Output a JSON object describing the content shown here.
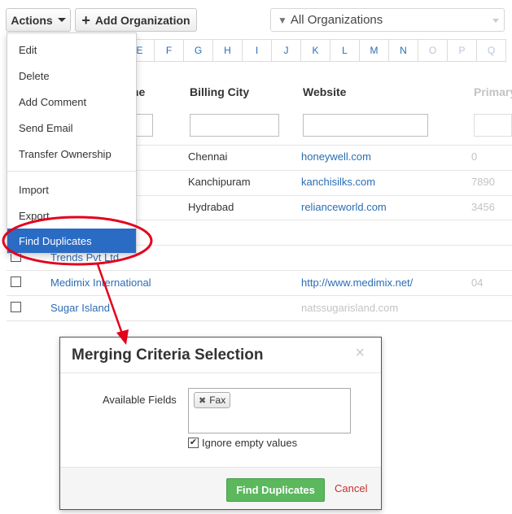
{
  "toolbar": {
    "actions_label": "Actions",
    "add_org_label": "Add Organization",
    "filter_select": "All Organizations"
  },
  "alphabet": [
    "E",
    "F",
    "G",
    "H",
    "I",
    "J",
    "K",
    "L",
    "M",
    "N",
    "O",
    "P",
    "Q"
  ],
  "table": {
    "headers": {
      "name_partial": "me",
      "billing_city": "Billing City",
      "website": "Website",
      "primary": "Primary"
    },
    "rows": [
      {
        "name": "",
        "city": "Chennai",
        "website": "honeywell.com",
        "phone": "0"
      },
      {
        "name": "",
        "city": "Kanchipuram",
        "website": "kanchisilks.com",
        "phone": "7890"
      },
      {
        "name": "",
        "city": "Hydrabad",
        "website": "relianceworld.com",
        "phone": "3456"
      },
      {
        "name": "Trends Pvt Ltd",
        "city": "",
        "website": "",
        "phone": ""
      },
      {
        "name": "Medimix International",
        "city": "",
        "website": "http://www.medimix.net/",
        "phone": "04"
      },
      {
        "name": "Sugar Island",
        "city": "",
        "website": "natssugarisland.com",
        "phone": ""
      }
    ]
  },
  "actions_menu": {
    "items": [
      "Edit",
      "Delete",
      "Add Comment",
      "Send Email",
      "Transfer Ownership",
      "Import",
      "Export",
      "Find Duplicates"
    ],
    "active": "Find Duplicates"
  },
  "modal": {
    "title": "Merging Criteria Selection",
    "close_symbol": "×",
    "fields_label": "Available Fields",
    "selected_fields": [
      "Fax"
    ],
    "ignore_empty_label": "Ignore empty values",
    "ignore_empty_checked": true,
    "primary_button": "Find Duplicates",
    "cancel_label": "Cancel"
  },
  "colors": {
    "link": "#2a6db5",
    "menu_active": "#2a6bc4",
    "annotation": "#e3001b",
    "primary_button": "#5bb85d",
    "cancel": "#c9302c"
  }
}
